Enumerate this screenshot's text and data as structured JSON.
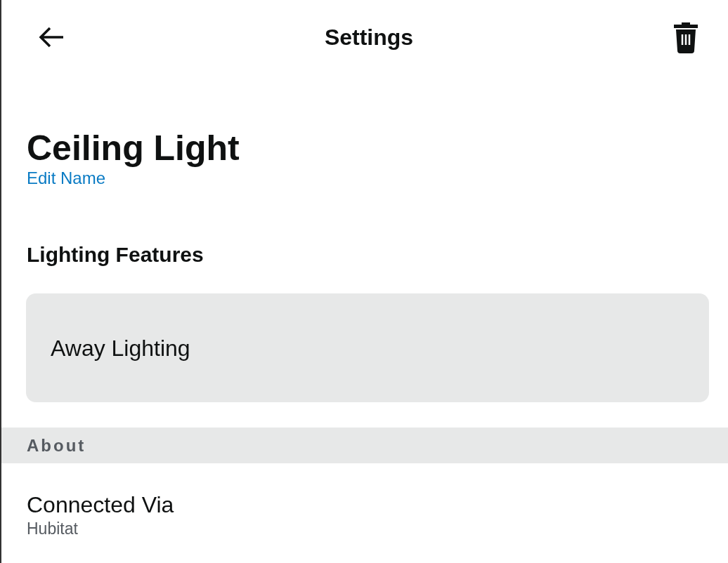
{
  "header": {
    "title": "Settings"
  },
  "device": {
    "name": "Ceiling Light",
    "edit_link": "Edit Name"
  },
  "lighting_features": {
    "heading": "Lighting Features",
    "items": [
      {
        "label": "Away Lighting"
      }
    ]
  },
  "about": {
    "heading": "About",
    "rows": [
      {
        "label": "Connected Via",
        "value": "Hubitat"
      }
    ]
  }
}
